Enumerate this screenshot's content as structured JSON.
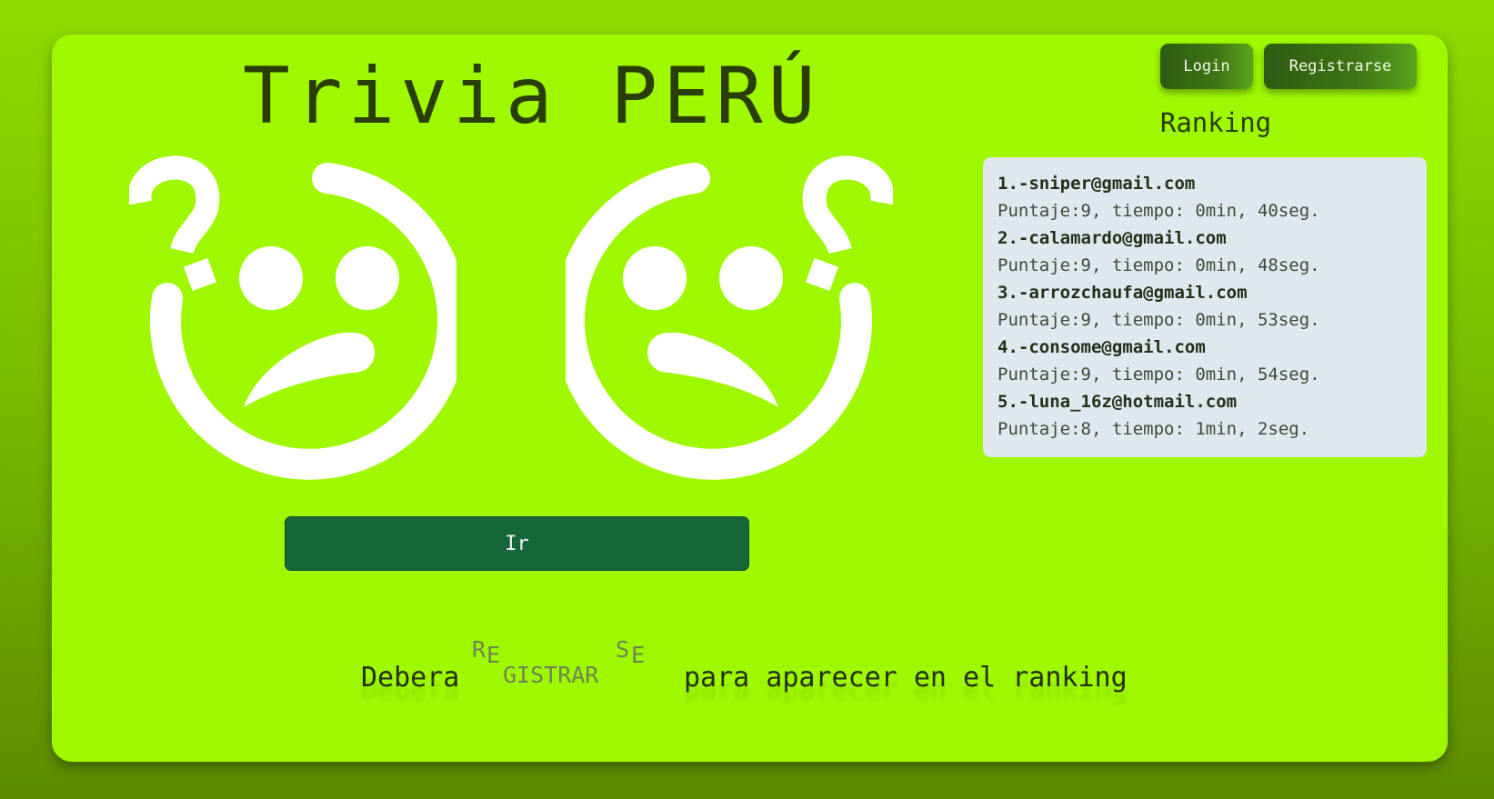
{
  "app": {
    "title": "Trivia PERÚ"
  },
  "nav": {
    "login_label": "Login",
    "register_label": "Registrarse"
  },
  "ranking": {
    "heading": "Ranking",
    "entries": [
      {
        "email": "1.-sniper@gmail.com",
        "detail": "Puntaje:9, tiempo: 0min, 40seg."
      },
      {
        "email": "2.-calamardo@gmail.com",
        "detail": "Puntaje:9, tiempo: 0min, 48seg."
      },
      {
        "email": "3.-arrozchaufa@gmail.com",
        "detail": "Puntaje:9, tiempo: 0min, 53seg."
      },
      {
        "email": "4.-consome@gmail.com",
        "detail": "Puntaje:9, tiempo: 0min, 54seg."
      },
      {
        "email": "5.-luna_16z@hotmail.com",
        "detail": "Puntaje:8, tiempo: 1min, 2seg."
      }
    ]
  },
  "main": {
    "go_label": "Ir",
    "face_icon": "confused-face-icon"
  },
  "footer": {
    "text_before": "Debera",
    "link_parts": [
      "R",
      "E",
      "GISTRAR",
      "S",
      "E"
    ],
    "text_after": "para aparecer en el ranking"
  },
  "colors": {
    "background": "#8fdb00",
    "card": "#a0f800",
    "title_text": "#2a3d06",
    "go_button": "#15673a",
    "ranking_box": "#e0e7ee",
    "link_text": "#6f8552"
  }
}
